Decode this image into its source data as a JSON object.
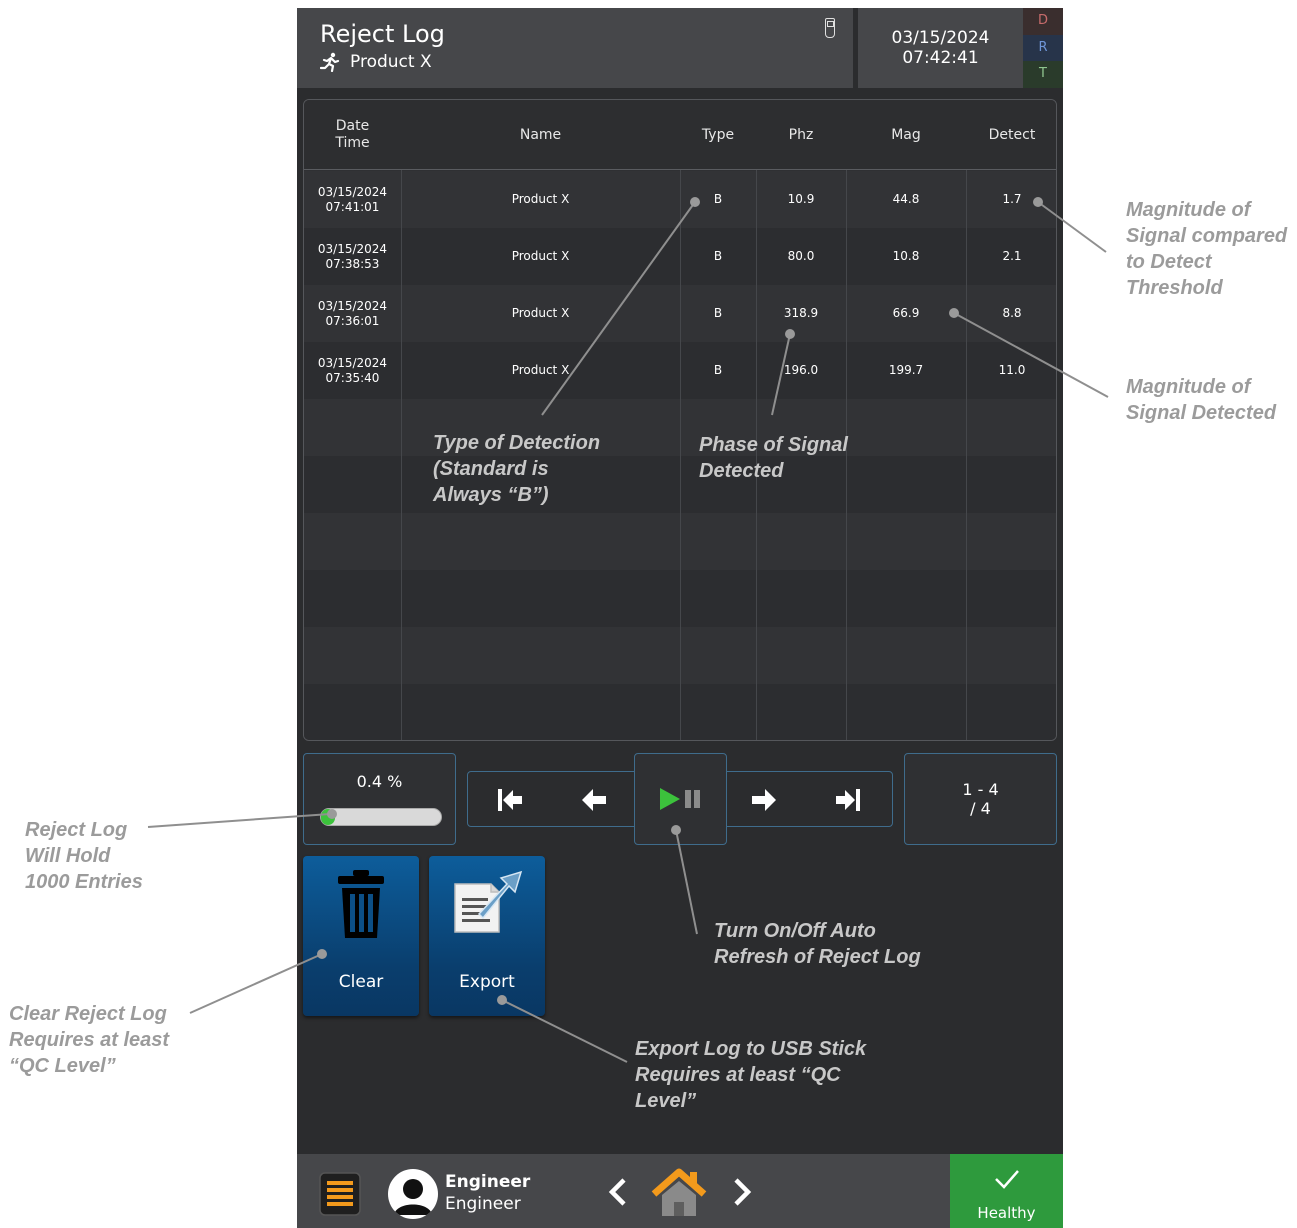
{
  "header": {
    "title": "Reject Log",
    "product": "Product X",
    "date": "03/15/2024",
    "time": "07:42:41",
    "status_letters": [
      "D",
      "R",
      "T"
    ]
  },
  "table": {
    "columns": {
      "datetime": "Date\nTime",
      "name": "Name",
      "type": "Type",
      "phz": "Phz",
      "mag": "Mag",
      "detect": "Detect"
    },
    "rows": [
      {
        "datetime": "03/15/2024\n07:41:01",
        "name": "Product X",
        "type": "B",
        "phz": "10.9",
        "mag": "44.8",
        "detect": "1.7"
      },
      {
        "datetime": "03/15/2024\n07:38:53",
        "name": "Product X",
        "type": "B",
        "phz": "80.0",
        "mag": "10.8",
        "detect": "2.1"
      },
      {
        "datetime": "03/15/2024\n07:36:01",
        "name": "Product X",
        "type": "B",
        "phz": "318.9",
        "mag": "66.9",
        "detect": "8.8"
      },
      {
        "datetime": "03/15/2024\n07:35:40",
        "name": "Product X",
        "type": "B",
        "phz": "196.0",
        "mag": "199.7",
        "detect": "11.0"
      }
    ],
    "empty_row_count": 6
  },
  "controls": {
    "capacity_text": "0.4 %",
    "capacity_fraction": 0.004,
    "page_range": "1 - 4",
    "page_total": "/ 4",
    "icons": [
      "first-page-icon",
      "prev-page-icon",
      "play-pause-icon",
      "next-page-icon",
      "last-page-icon"
    ]
  },
  "actions": {
    "clear_label": "Clear",
    "export_label": "Export"
  },
  "footer": {
    "user_name": "Engineer",
    "user_role": "Engineer",
    "health_label": "Healthy",
    "colors": {
      "health": "#2e9a3d",
      "home": "#f39a1c",
      "menu": "#f39a1c"
    }
  },
  "annotations": {
    "detect_note": "Magnitude of\nSignal compared\nto Detect\nThreshold",
    "mag_note": "Magnitude of\nSignal Detected",
    "type_note": "Type of Detection\n(Standard is\nAlways “B”)",
    "phase_note": "Phase of Signal\nDetected",
    "capacity_note": "Reject Log\nWill Hold\n1000 Entries",
    "refresh_note": "Turn On/Off Auto\nRefresh of Reject Log",
    "clear_note": "Clear Reject Log\nRequires at least\n“QC Level”",
    "export_note": "Export Log to USB Stick\nRequires at least “QC\nLevel”"
  },
  "colors": {
    "accent_border": "#3f6c8c",
    "button_blue": "#0a4a80",
    "play_green": "#3cc23c",
    "annotation_gray": "#9b9b9b"
  }
}
